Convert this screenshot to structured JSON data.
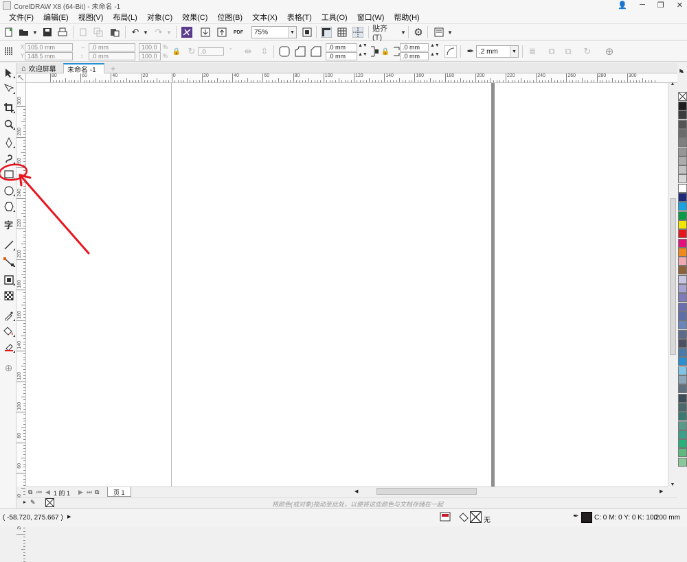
{
  "titlebar": {
    "title": "CorelDRAW X8 (64-Bit) - 未命名 -1",
    "buttons": [
      "👤",
      "─",
      "❐",
      "✕"
    ]
  },
  "menubar": {
    "items": [
      "文件(F)",
      "编辑(E)",
      "视图(V)",
      "布局(L)",
      "对象(C)",
      "效果(C)",
      "位图(B)",
      "文本(X)",
      "表格(T)",
      "工具(O)",
      "窗口(W)",
      "帮助(H)"
    ]
  },
  "standard_toolbar": {
    "zoom": "75%",
    "snap_label": "贴齐(T)",
    "pdf_label": "PDF"
  },
  "property_bar": {
    "x": "105.0 mm",
    "y": "148.5 mm",
    "width": ".0 mm",
    "height": ".0 mm",
    "scale_w": "100.0",
    "scale_h": "100.0",
    "percent": "%",
    "rotation": ".0",
    "corner_1": ".0 mm",
    "corner_2": ".0 mm",
    "corner_3": ".0 mm",
    "corner_4": ".0 mm",
    "outline_width": ".2 mm"
  },
  "document_tabs": [
    {
      "label": "欢迎屏幕",
      "active": false
    },
    {
      "label": "未命名 -1",
      "active": true
    }
  ],
  "rulers": {
    "horizontal_labels": [
      "80",
      "60",
      "40",
      "20",
      "0",
      "20",
      "40",
      "60",
      "80",
      "100",
      "120",
      "140",
      "160",
      "180",
      "200",
      "220",
      "240",
      "260",
      "280",
      "300"
    ],
    "vertical_labels": [
      "300",
      "280",
      "260",
      "240",
      "220",
      "200",
      "180",
      "160",
      "140",
      "120",
      "100",
      "80",
      "60",
      "40",
      "20"
    ]
  },
  "toolbox": {
    "tools": [
      "pick-tool-icon",
      "shape-tool-icon",
      "crop-tool-icon",
      "zoom-tool-icon",
      "freehand-tool-icon",
      "artistic-media-tool-icon",
      "rectangle-tool-icon",
      "ellipse-tool-icon",
      "polygon-tool-icon",
      "text-tool-icon",
      "parallel-dimension-tool-icon",
      "connector-tool-icon",
      "drop-shadow-tool-icon",
      "transparency-tool-icon",
      "color-eyedropper-tool-icon",
      "interactive-fill-tool-icon",
      "smart-fill-tool-icon",
      "add-tool-icon"
    ],
    "text_tool_glyph": "字"
  },
  "palette": {
    "colors": [
      "#231f20",
      "#3c3c3c",
      "#555555",
      "#6b6b6b",
      "#808080",
      "#969696",
      "#acacac",
      "#c2c2c2",
      "#d8d8d8",
      "#ffffff",
      "#1e2a78",
      "#1aa3e0",
      "#0c9a46",
      "#f2e500",
      "#e8141e",
      "#e4127c",
      "#f08a1a",
      "#eeaab0",
      "#8c6239",
      "#c8c6e2",
      "#a6a3d1",
      "#7e7bb8",
      "#6b6fae",
      "#5f6ea8",
      "#6a86b8",
      "#5d6a8a",
      "#4d4f63",
      "#4a7aa8",
      "#2a8fd0",
      "#7ec3e8",
      "#8aa6b8",
      "#60707e",
      "#3e4e58",
      "#4a6a6a",
      "#3a7a70",
      "#5a9a8a",
      "#3aa088",
      "#2ab07a",
      "#60b880",
      "#8ac89a"
    ]
  },
  "page_nav": {
    "page_count": "1 的 1",
    "page_tab": "页 1"
  },
  "hint": "将颜色(或对象)拖动至此处，以便将这些颜色与文档存储在一起",
  "statusbar": {
    "coords": "( -58.720, 275.667 )",
    "fill_none": "无",
    "outline_color": "C: 0 M: 0 Y: 0 K: 100",
    "outline_width": ".200 mm"
  },
  "colors": {
    "annotation_red": "#e8141e",
    "outline_swatch": "#231f20"
  }
}
